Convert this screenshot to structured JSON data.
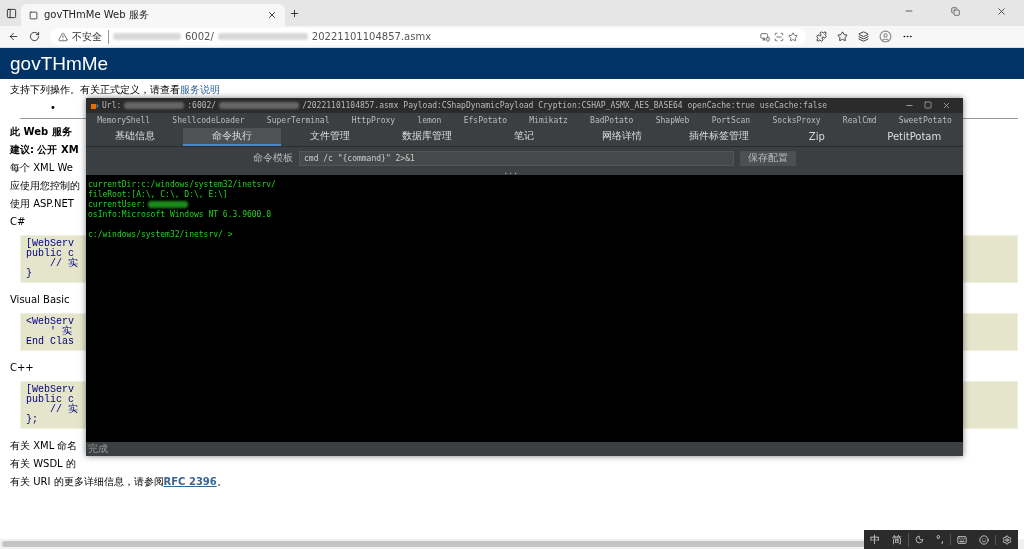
{
  "browser": {
    "tab": {
      "title": "govTHmMe Web 服务",
      "selected": true
    },
    "address": {
      "security_label": "不安全",
      "url_parts": [
        "6002/",
        "20221101104857.asmx"
      ]
    }
  },
  "page": {
    "header": "govTHmMe",
    "intro": "支持下列操作。有关正式定义，请查看",
    "intro_link": "服务说明",
    "bullet": "•",
    "blocks": [
      {
        "kind": "heading",
        "text": "此 Web 服务"
      },
      {
        "kind": "heading",
        "text": "建议: 公开 XM"
      },
      {
        "kind": "para",
        "text": "每个 XML We"
      },
      {
        "kind": "para",
        "text": "应使用您控制的"
      },
      {
        "kind": "para",
        "text": "使用 ASP.NET"
      },
      {
        "kind": "para",
        "text": "C#"
      },
      {
        "kind": "code",
        "lines": [
          "[WebServ",
          "public c",
          "    // 实",
          "}"
        ]
      },
      {
        "kind": "para",
        "text": "Visual Basic"
      },
      {
        "kind": "code",
        "lines": [
          "<WebServ",
          "    ' 实",
          "End Clas"
        ]
      },
      {
        "kind": "para",
        "text": "C++"
      },
      {
        "kind": "code",
        "lines": [
          "[WebServ",
          "public c",
          "    // 实",
          "};"
        ]
      },
      {
        "kind": "para",
        "text": "有关 XML 命名"
      },
      {
        "kind": "para",
        "text": "有关 WSDL 的"
      }
    ],
    "footer_text": "有关 URI 的更多详细信息，请参阅 ",
    "footer_link": "RFC 2396",
    "footer_end": "。"
  },
  "app": {
    "title_parts": [
      "Url:",
      ":6002/",
      "/20221101104857.asmx Payload:CShapDynamicPayload Cryption:CSHAP_ASMX_AES_BASE64 openCache:true useCache:false"
    ],
    "plugins": [
      "MemoryShell",
      "ShellcodeLoader",
      "SuperTerminal",
      "HttpProxy",
      "lemon",
      "EfsPotato",
      "Mimikatz",
      "BadPotato",
      "ShapWeb",
      "PortScan",
      "SocksProxy",
      "RealCmd",
      "SweetPotato"
    ],
    "tabs": [
      {
        "label": "基础信息",
        "selected": false
      },
      {
        "label": "命令执行",
        "selected": true
      },
      {
        "label": "文件管理",
        "selected": false
      },
      {
        "label": "数据库管理",
        "selected": false
      },
      {
        "label": "笔记",
        "selected": false
      },
      {
        "label": "网络详情",
        "selected": false
      },
      {
        "label": "插件标签管理",
        "selected": false
      },
      {
        "label": "Zip",
        "selected": false
      },
      {
        "label": "PetitPotam",
        "selected": false
      }
    ],
    "template_label": "命令模板",
    "template_value": "cmd /c \"{command}\" 2>&1",
    "save_button": "保存配置",
    "splitter": "...",
    "terminal": [
      {
        "kind": "text",
        "text": "currentDir:c:/windows/system32/inetsrv/"
      },
      {
        "kind": "text",
        "text": "fileRoot:[A:\\, C:\\, D:\\, E:\\]"
      },
      {
        "kind": "redacted",
        "text": "currentUser:"
      },
      {
        "kind": "text",
        "text": "osInfo:Microsoft Windows NT 6.3.9600.0"
      },
      {
        "kind": "blank"
      },
      {
        "kind": "text",
        "text": "c:/windows/system32/inetsrv/ >"
      }
    ],
    "status": "完成"
  },
  "ime": {
    "mode": "中",
    "script": "简",
    "punct": "°,"
  }
}
